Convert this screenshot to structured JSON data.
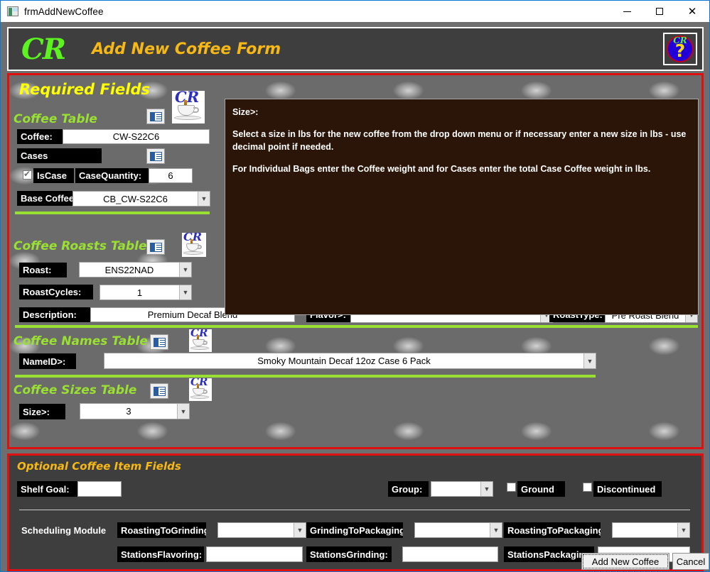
{
  "window": {
    "title": "frmAddNewCoffee",
    "icon": "form-icon",
    "controls": {
      "minimize": "minimize-icon",
      "maximize": "maximize-icon",
      "close": "close-icon"
    }
  },
  "header": {
    "logo_text": "CR",
    "title": "Add New Coffee Form",
    "help_button": {
      "cr_text": "CR",
      "question_mark": "?"
    }
  },
  "required_section": {
    "title": "Required Fields",
    "coffee_table": {
      "title": "Coffee Table",
      "fields": {
        "coffee_label": "Coffee:",
        "coffee_value": "CW-S22C6",
        "cases_label": "Cases",
        "iscase_label": "IsCase",
        "iscase_checked": true,
        "casequantity_label": "CaseQuantity:",
        "casequantity_value": "6",
        "basecoffee_label": "Base Coffee",
        "basecoffee_value": "CB_CW-S22C6"
      }
    },
    "coffee_roasts_table": {
      "title": "Coffee Roasts Table",
      "fields": {
        "roast_label": "Roast:",
        "roast_value": "ENS22NAD",
        "roastcycles_label": "RoastCycles:",
        "roastcycles_value": "1",
        "description_label": "Description:",
        "description_value": "Premium Decaf Blend",
        "flavor_label": "Flavor>:",
        "flavor_value": "",
        "roasttype_label": "RoastType:",
        "roasttype_value": "Pre Roast Blend"
      }
    },
    "coffee_names_table": {
      "title": "Coffee Names Table",
      "fields": {
        "nameid_label": "NameID>:",
        "nameid_value": "Smoky Mountain  Decaf 12oz Case 6 Pack"
      }
    },
    "coffee_sizes_table": {
      "title": "Coffee Sizes Table",
      "fields": {
        "size_label": "Size>:",
        "size_value": "3"
      }
    }
  },
  "help_panel": {
    "heading": "Size>:",
    "paragraph_1": "Select a size in lbs for the new coffee from the drop down menu or if necessary enter a new size in lbs - use decimal point if needed.",
    "paragraph_2": "For Individual Bags enter the Coffee weight and for Cases enter the total Case Coffee weight in lbs."
  },
  "optional_section": {
    "title": "Optional Coffee Item Fields",
    "fields": {
      "shelfgoal_label": "Shelf Goal:",
      "shelfgoal_value": "",
      "group_label": "Group:",
      "group_value": "",
      "ground_label": "Ground",
      "ground_checked": false,
      "discontinued_label": "Discontinued",
      "discontinued_checked": false
    },
    "scheduling": {
      "title": "Scheduling Module",
      "roastingtogrinding_label": "RoastingToGrinding:",
      "roastingtogrinding_value": "",
      "grindingtopackaging_label": "GrindingToPackaging:",
      "grindingtopackaging_value": "",
      "roastingtopackaging_label": "RoastingToPackaging:",
      "roastingtopackaging_value": "",
      "stationsflavoring_label": "StationsFlavoring:",
      "stationsflavoring_value": "",
      "stationsgrinding_label": "StationsGrinding:",
      "stationsgrinding_value": "",
      "stationspackaging_label": "StationsPackaging:",
      "stationspackaging_value": ""
    }
  },
  "footer": {
    "add_button": "Add New Coffee",
    "cancel_button": "Cancel"
  },
  "colors": {
    "accent_red": "#e01010",
    "accent_green": "#9ae032",
    "accent_yellow": "#ffff00",
    "accent_orange": "#f6b816",
    "logo_green": "#5cf321",
    "header_bg": "#3e3e3e",
    "help_bg": "#2b1508"
  }
}
